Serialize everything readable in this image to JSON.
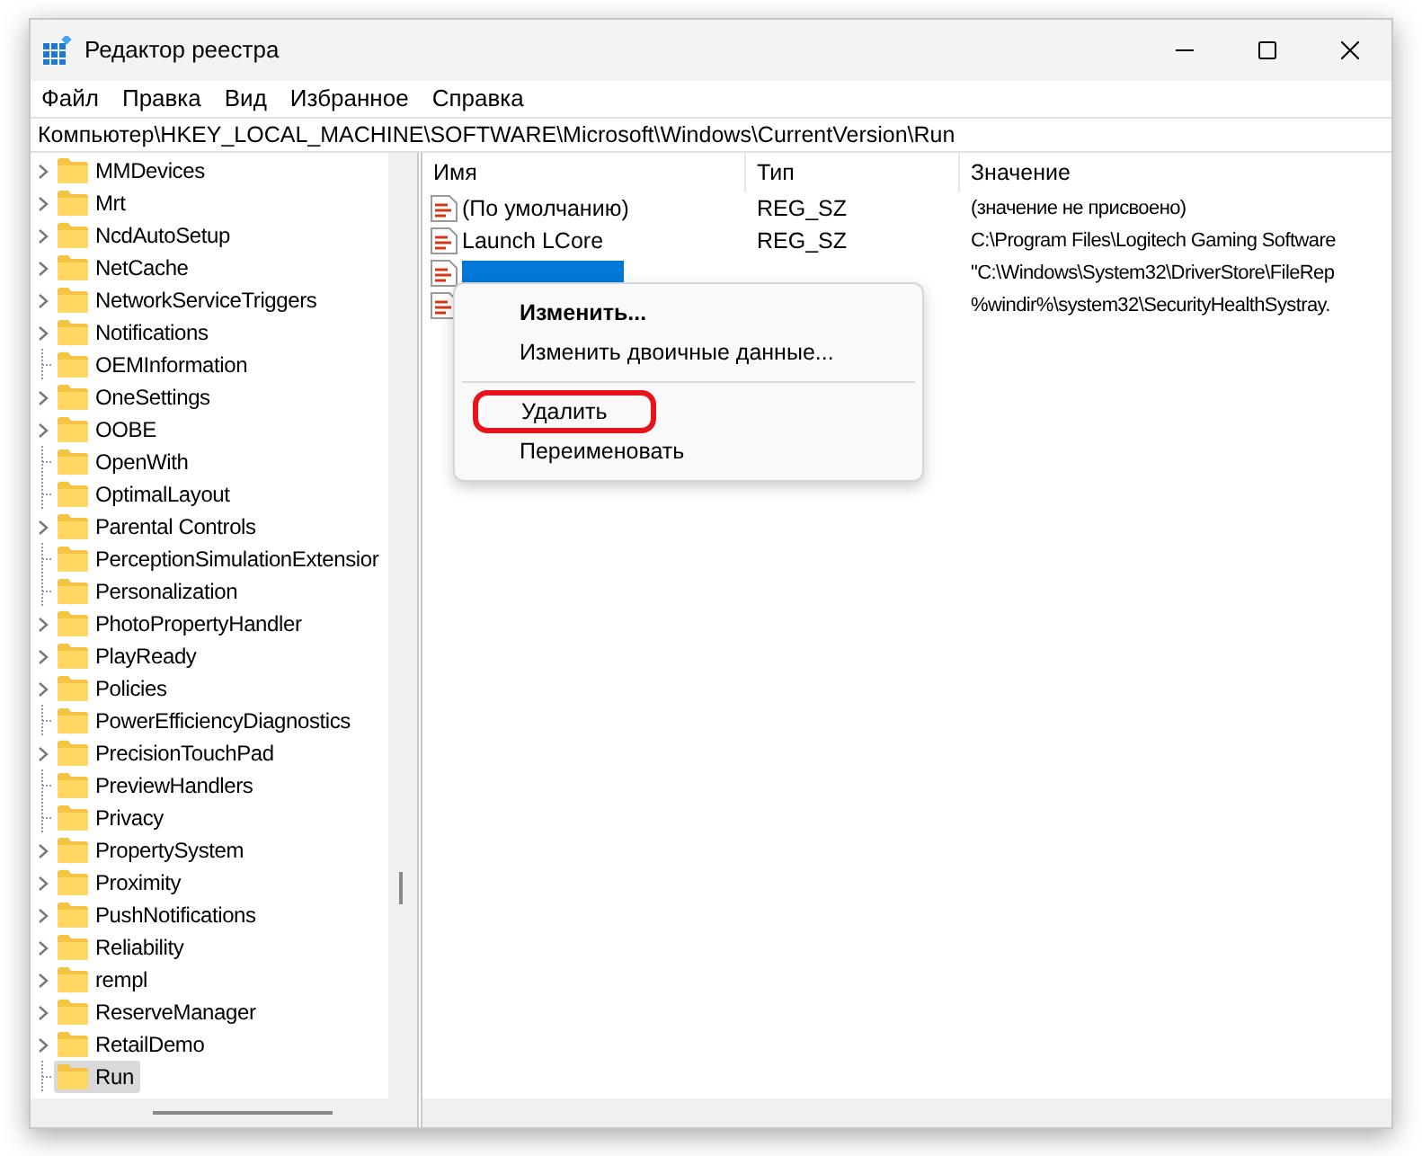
{
  "window": {
    "title": "Редактор реестра"
  },
  "menu": [
    "Файл",
    "Правка",
    "Вид",
    "Избранное",
    "Справка"
  ],
  "address": "Компьютер\\HKEY_LOCAL_MACHINE\\SOFTWARE\\Microsoft\\Windows\\CurrentVersion\\Run",
  "tree": [
    {
      "label": "MMDevices",
      "expandable": true,
      "selected": false
    },
    {
      "label": "Mrt",
      "expandable": true,
      "selected": false
    },
    {
      "label": "NcdAutoSetup",
      "expandable": true,
      "selected": false
    },
    {
      "label": "NetCache",
      "expandable": true,
      "selected": false
    },
    {
      "label": "NetworkServiceTriggers",
      "expandable": true,
      "selected": false
    },
    {
      "label": "Notifications",
      "expandable": true,
      "selected": false
    },
    {
      "label": "OEMInformation",
      "expandable": false,
      "selected": false
    },
    {
      "label": "OneSettings",
      "expandable": true,
      "selected": false
    },
    {
      "label": "OOBE",
      "expandable": true,
      "selected": false
    },
    {
      "label": "OpenWith",
      "expandable": false,
      "selected": false
    },
    {
      "label": "OptimalLayout",
      "expandable": false,
      "selected": false
    },
    {
      "label": "Parental Controls",
      "expandable": true,
      "selected": false
    },
    {
      "label": "PerceptionSimulationExtensior",
      "expandable": false,
      "selected": false
    },
    {
      "label": "Personalization",
      "expandable": false,
      "selected": false
    },
    {
      "label": "PhotoPropertyHandler",
      "expandable": true,
      "selected": false
    },
    {
      "label": "PlayReady",
      "expandable": true,
      "selected": false
    },
    {
      "label": "Policies",
      "expandable": true,
      "selected": false
    },
    {
      "label": "PowerEfficiencyDiagnostics",
      "expandable": false,
      "selected": false
    },
    {
      "label": "PrecisionTouchPad",
      "expandable": true,
      "selected": false
    },
    {
      "label": "PreviewHandlers",
      "expandable": false,
      "selected": false
    },
    {
      "label": "Privacy",
      "expandable": false,
      "selected": false
    },
    {
      "label": "PropertySystem",
      "expandable": true,
      "selected": false
    },
    {
      "label": "Proximity",
      "expandable": true,
      "selected": false
    },
    {
      "label": "PushNotifications",
      "expandable": true,
      "selected": false
    },
    {
      "label": "Reliability",
      "expandable": true,
      "selected": false
    },
    {
      "label": "rempl",
      "expandable": true,
      "selected": false
    },
    {
      "label": "ReserveManager",
      "expandable": true,
      "selected": false
    },
    {
      "label": "RetailDemo",
      "expandable": true,
      "selected": false
    },
    {
      "label": "Run",
      "expandable": false,
      "selected": true
    }
  ],
  "table": {
    "columns": [
      "Имя",
      "Тип",
      "Значение"
    ],
    "rows": [
      {
        "name": "(По умолчанию)",
        "type": "REG_SZ",
        "value": "(значение не присвоено)",
        "selected": false
      },
      {
        "name": "Launch LCore",
        "type": "REG_SZ",
        "value": "C:\\Program Files\\Logitech Gaming Software",
        "selected": false
      },
      {
        "value": "\"C:\\Windows\\System32\\DriverStore\\FileRep",
        "selected": true
      },
      {
        "value": "%windir%\\system32\\SecurityHealthSystray.",
        "selected": false
      }
    ]
  },
  "context_menu": [
    {
      "label": "Изменить...",
      "bold": true,
      "highlighted": false
    },
    {
      "label": "Изменить двоичные данные...",
      "bold": false,
      "highlighted": false
    },
    {
      "kind": "separator"
    },
    {
      "label": "Удалить",
      "bold": false,
      "highlighted": true
    },
    {
      "label": "Переименовать",
      "bold": false,
      "highlighted": false
    }
  ]
}
